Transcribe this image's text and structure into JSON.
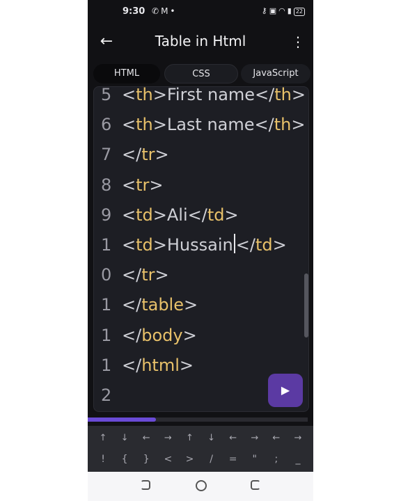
{
  "status": {
    "time": "9:30",
    "left_icons": [
      "notification-icon",
      "call-icon",
      "gmail-icon",
      "dot-icon"
    ],
    "right_icons": [
      "vpn-key-icon",
      "cast-icon",
      "wifi-icon",
      "signal-icon"
    ],
    "battery": "22"
  },
  "header": {
    "title": "Table in Html"
  },
  "tabs": [
    {
      "label": "HTML",
      "active": true
    },
    {
      "label": "CSS",
      "active": false
    },
    {
      "label": "JavaScript",
      "active": false
    }
  ],
  "editor": {
    "lines": [
      {
        "n": "5",
        "code": "<th>First name</th>"
      },
      {
        "n": "6",
        "code": "<th>Last name</th>"
      },
      {
        "n": "7",
        "code": "</tr>"
      },
      {
        "n": "8",
        "code": "<tr>"
      },
      {
        "n": "9",
        "code": "<td>Ali</td>"
      },
      {
        "n": "1",
        "code": "<td>Hussain</td>"
      },
      {
        "n": "0",
        "code": "</tr>"
      },
      {
        "n": "1",
        "code": "</table>"
      },
      {
        "n": "1",
        "code": "</body>"
      },
      {
        "n": "1",
        "code": "</html>"
      },
      {
        "n": "2",
        "code": ""
      }
    ],
    "run_icon": "play-icon"
  },
  "progress": {
    "value": 0.31
  },
  "keyboard": {
    "row1": [
      "↑",
      "↓",
      "←",
      "→",
      "↑",
      "↓",
      "←",
      "→",
      "←",
      "→"
    ],
    "row2": [
      "!",
      "{",
      "}",
      "<",
      ">",
      "/",
      "=",
      "\"",
      ";",
      "_"
    ]
  },
  "navbar": {
    "icons": [
      "recents-icon",
      "home-icon",
      "back-icon"
    ]
  },
  "colors": {
    "tag": "#e8c16a",
    "accent": "#5b3aa3",
    "progress": "#6a4bd6"
  }
}
